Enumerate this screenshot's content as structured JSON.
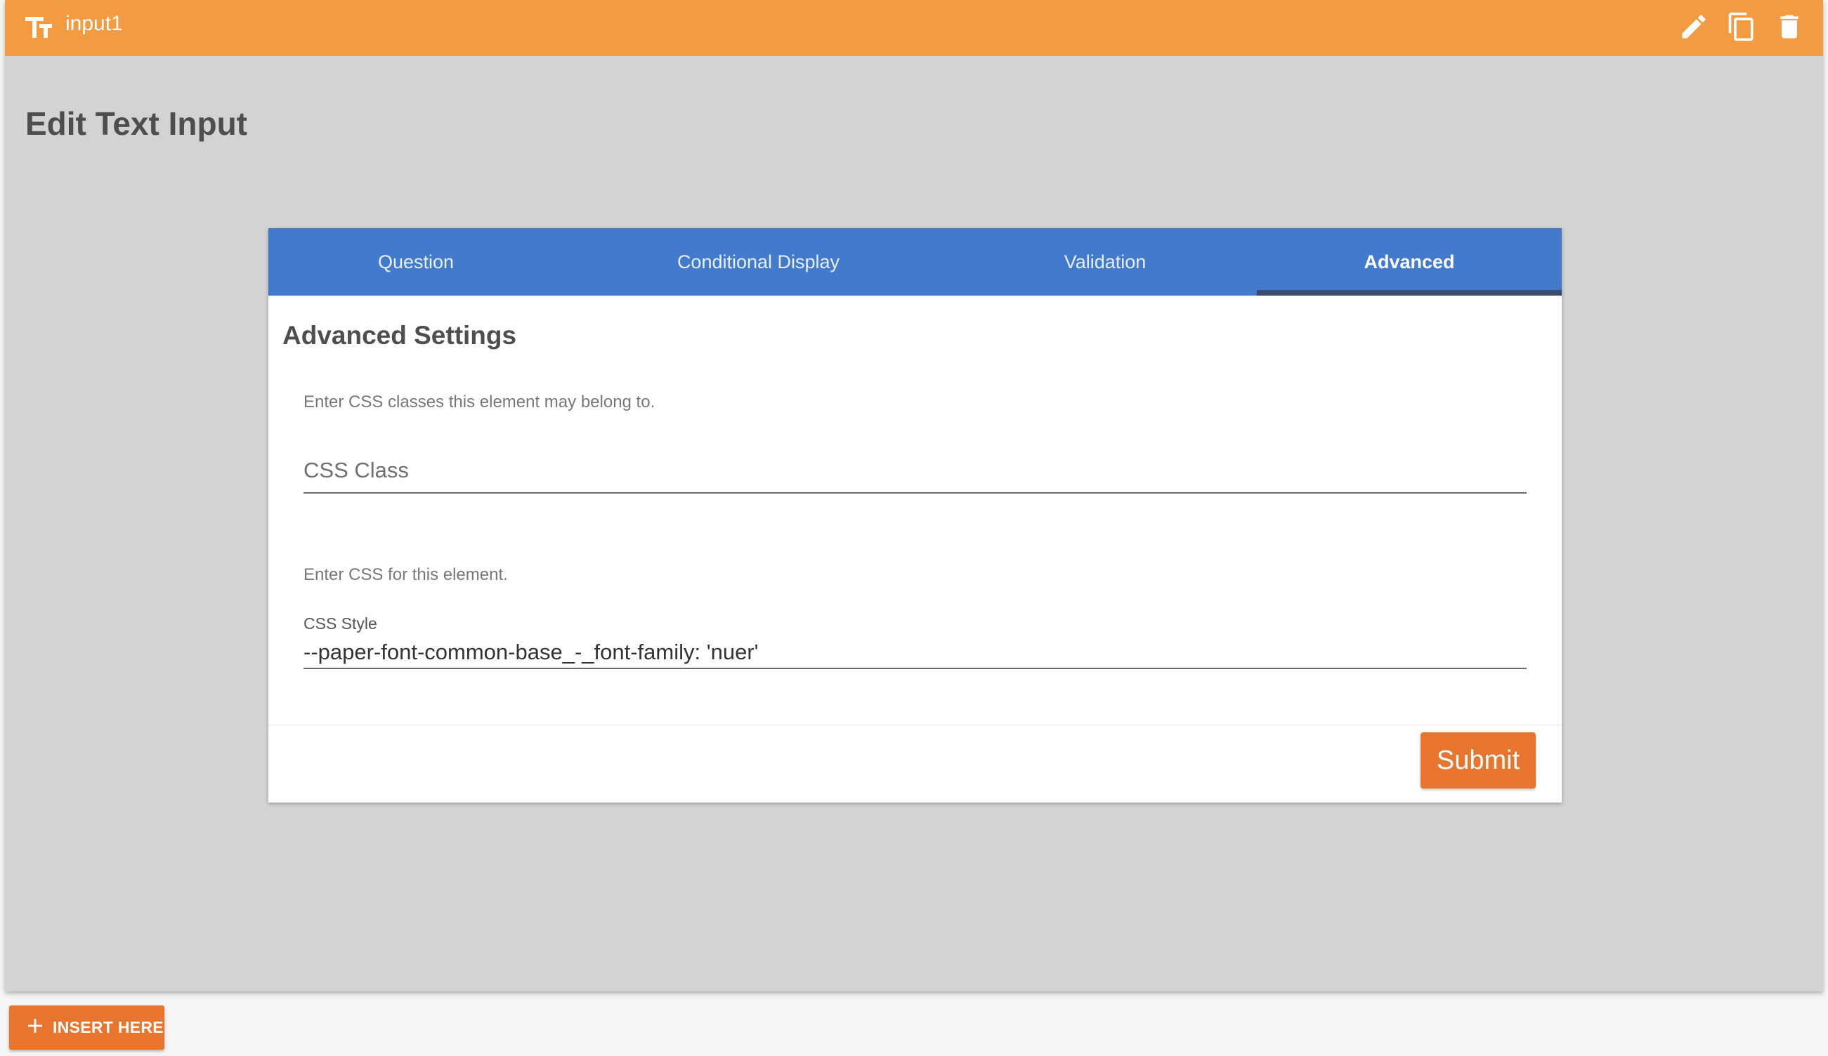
{
  "header": {
    "title": "input1",
    "type_icon": "text-fields-icon",
    "actions": [
      {
        "name": "edit",
        "icon": "pencil-icon"
      },
      {
        "name": "copy",
        "icon": "copy-icon"
      },
      {
        "name": "delete",
        "icon": "trash-icon"
      }
    ]
  },
  "page_title": "Edit Text Input",
  "tabs": [
    {
      "label": "Question",
      "active": false
    },
    {
      "label": "Conditional Display",
      "active": false
    },
    {
      "label": "Validation",
      "active": false
    },
    {
      "label": "Advanced",
      "active": true
    }
  ],
  "advanced": {
    "section_title": "Advanced Settings",
    "css_class_help": "Enter CSS classes this element may belong to.",
    "css_class_placeholder": "CSS Class",
    "css_class_value": "",
    "css_style_help": "Enter CSS for this element.",
    "css_style_label": "CSS Style",
    "css_style_value": "--paper-font-common-base_-_font-family: 'nuer'"
  },
  "submit_label": "Submit",
  "insert_label": "INSERT HERE",
  "colors": {
    "header": "#f29b40",
    "tabs": "#427bce",
    "tab_indicator": "#3b4c6e",
    "accent_button": "#e8752e",
    "background": "#d3d3d3"
  }
}
